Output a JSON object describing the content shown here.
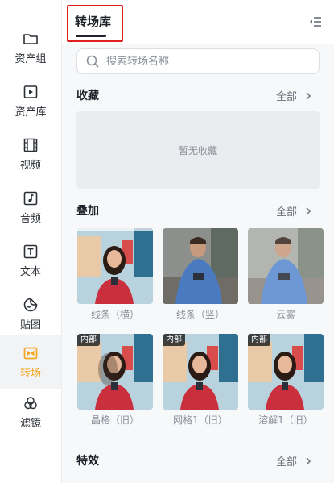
{
  "rail": {
    "items": [
      {
        "label": "资产组",
        "icon": "folder-icon"
      },
      {
        "label": "资产库",
        "icon": "play-box-icon"
      },
      {
        "label": "视频",
        "icon": "film-icon"
      },
      {
        "label": "音频",
        "icon": "music-note-icon"
      },
      {
        "label": "文本",
        "icon": "text-t-icon"
      },
      {
        "label": "贴图",
        "icon": "sticker-icon"
      },
      {
        "label": "转场",
        "icon": "transition-icon",
        "active": true
      },
      {
        "label": "滤镜",
        "icon": "filter-circles-icon"
      }
    ]
  },
  "panel": {
    "title": "转场库",
    "search_placeholder": "搜索转场名称"
  },
  "sections": {
    "favorites": {
      "title": "收藏",
      "all_label": "全部",
      "empty_text": "暂无收藏"
    },
    "overlay": {
      "title": "叠加",
      "all_label": "全部",
      "cards": [
        {
          "label": "线条（横）",
          "badge": ""
        },
        {
          "label": "线条（竖）",
          "badge": ""
        },
        {
          "label": "云雾",
          "badge": ""
        },
        {
          "label": "晶格（旧）",
          "badge": "内部"
        },
        {
          "label": "网格1（旧）",
          "badge": "内部"
        },
        {
          "label": "溶解1（旧）",
          "badge": "内部"
        }
      ]
    },
    "effects": {
      "title": "特效",
      "all_label": "全部"
    }
  },
  "colors": {
    "accent": "#f5a623",
    "highlight_border": "#e02020",
    "panel_bg": "#f7f8fa",
    "empty_box_bg": "#ebecef"
  }
}
